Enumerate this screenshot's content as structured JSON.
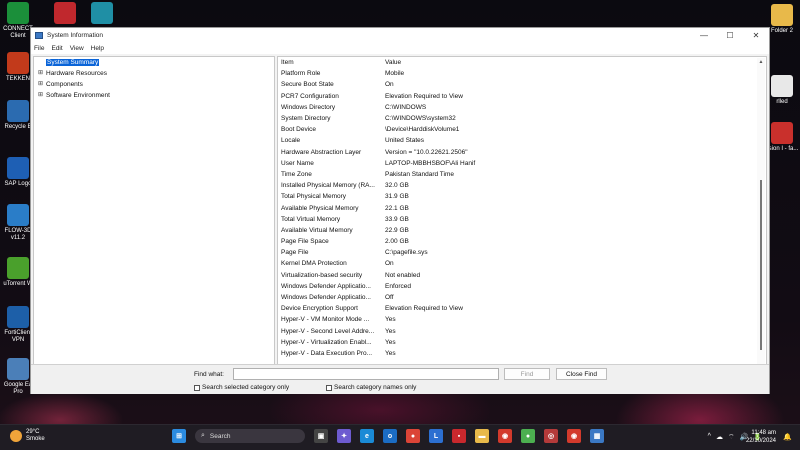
{
  "desktop": {
    "icons_left": [
      {
        "label": "CONNECT Client",
        "icon": "connect-icon",
        "color": "#1b8f3a"
      },
      {
        "label": "TEKKEN",
        "icon": "tekken-icon",
        "color": "#c23a1b"
      },
      {
        "label": "Recycle B",
        "icon": "recycle-bin-icon",
        "color": "#2b6bb0"
      },
      {
        "label": "SAP Logo",
        "icon": "sap-icon",
        "color": "#1e5fb4"
      },
      {
        "label": "FLOW-3D v11.2",
        "icon": "flow3d-icon",
        "color": "#2a7dc8"
      },
      {
        "label": "uTorrent W",
        "icon": "utorrent-icon",
        "color": "#4aa02c"
      },
      {
        "label": "FortiClient VPN",
        "icon": "forticlient-icon",
        "color": "#1d5fa8"
      },
      {
        "label": "Google Ea Pro",
        "icon": "google-earth-icon",
        "color": "#4b7fb8"
      }
    ],
    "icons_top": [
      {
        "label": "",
        "icon": "autocad-icon",
        "color": "#c0282d"
      },
      {
        "label": "",
        "icon": "app-icon",
        "color": "#1f8fa5"
      }
    ],
    "icons_right": [
      {
        "label": "Folder 2",
        "icon": "folder-icon",
        "color": "#e8b94a"
      },
      {
        "label": "rlled",
        "icon": "file-icon",
        "color": "#e8e8e8"
      },
      {
        "label": "ssion I - fa...",
        "icon": "pdf-icon",
        "color": "#c9302c"
      }
    ]
  },
  "window": {
    "title": "System Information",
    "controls": {
      "minimize": "—",
      "maximize": "☐",
      "close": "✕"
    },
    "menu": [
      "File",
      "Edit",
      "View",
      "Help"
    ],
    "tree": [
      {
        "label": "System Summary",
        "expander": "",
        "selected": true
      },
      {
        "label": "Hardware Resources",
        "expander": "⊞",
        "selected": false
      },
      {
        "label": "Components",
        "expander": "⊞",
        "selected": false
      },
      {
        "label": "Software Environment",
        "expander": "⊞",
        "selected": false
      }
    ],
    "columns": {
      "item": "Item",
      "value": "Value"
    },
    "rows": [
      {
        "item": "Platform Role",
        "value": "Mobile"
      },
      {
        "item": "Secure Boot State",
        "value": "On"
      },
      {
        "item": "PCR7 Configuration",
        "value": "Elevation Required to View"
      },
      {
        "item": "Windows Directory",
        "value": "C:\\WINDOWS"
      },
      {
        "item": "System Directory",
        "value": "C:\\WINDOWS\\system32"
      },
      {
        "item": "Boot Device",
        "value": "\\Device\\HarddiskVolume1"
      },
      {
        "item": "Locale",
        "value": "United States"
      },
      {
        "item": "Hardware Abstraction Layer",
        "value": "Version = \"10.0.22621.2506\""
      },
      {
        "item": "User Name",
        "value": "LAPTOP-MBBHSBOF\\Ali Hanif"
      },
      {
        "item": "Time Zone",
        "value": "Pakistan Standard Time"
      },
      {
        "item": "Installed Physical Memory (RA...",
        "value": "32.0 GB"
      },
      {
        "item": "Total Physical Memory",
        "value": "31.9 GB"
      },
      {
        "item": "Available Physical Memory",
        "value": "22.1 GB"
      },
      {
        "item": "Total Virtual Memory",
        "value": "33.9 GB"
      },
      {
        "item": "Available Virtual Memory",
        "value": "22.9 GB"
      },
      {
        "item": "Page File Space",
        "value": "2.00 GB"
      },
      {
        "item": "Page File",
        "value": "C:\\pagefile.sys"
      },
      {
        "item": "Kernel DMA Protection",
        "value": "On"
      },
      {
        "item": "Virtualization-based security",
        "value": "Not enabled"
      },
      {
        "item": "Windows Defender Applicatio...",
        "value": "Enforced"
      },
      {
        "item": "Windows Defender Applicatio...",
        "value": "Off"
      },
      {
        "item": "Device Encryption Support",
        "value": "Elevation Required to View"
      },
      {
        "item": "Hyper-V - VM Monitor Mode ...",
        "value": "Yes"
      },
      {
        "item": "Hyper-V - Second Level Addre...",
        "value": "Yes"
      },
      {
        "item": "Hyper-V - Virtualization Enabl...",
        "value": "Yes"
      },
      {
        "item": "Hyper-V - Data Execution Pro...",
        "value": "Yes"
      }
    ],
    "find": {
      "label": "Find what:",
      "value": "",
      "find_button": "Find",
      "close_find_button": "Close Find",
      "search_selected": "Search selected category only",
      "search_names": "Search category names only"
    }
  },
  "taskbar": {
    "weather_temp": "29°C",
    "weather_desc": "Smoke",
    "search_label": "Search",
    "apps": [
      {
        "icon": "windows-start-icon",
        "color": "#2b8be0",
        "glyph": "⊞"
      },
      {
        "icon": "task-view-icon",
        "color": "#444",
        "glyph": "▣"
      },
      {
        "icon": "copilot-icon",
        "color": "#6d5bd0",
        "glyph": "✦"
      },
      {
        "icon": "edge-icon",
        "color": "#1a8ad6",
        "glyph": "e"
      },
      {
        "icon": "outlook-icon",
        "color": "#1b6cc4",
        "glyph": "o"
      },
      {
        "icon": "chrome-icon",
        "color": "#db4437",
        "glyph": "●"
      },
      {
        "icon": "lens-icon",
        "color": "#2c6fd1",
        "glyph": "L"
      },
      {
        "icon": "app-red-icon",
        "color": "#c8282d",
        "glyph": "▪"
      },
      {
        "icon": "file-explorer-icon",
        "color": "#e8b94a",
        "glyph": "▬"
      },
      {
        "icon": "camera-icon",
        "color": "#d33a2c",
        "glyph": "◉"
      },
      {
        "icon": "chrome-alt-icon",
        "color": "#4caf50",
        "glyph": "●"
      },
      {
        "icon": "zoom-icon",
        "color": "#b43a3a",
        "glyph": "◎"
      },
      {
        "icon": "recorder-icon",
        "color": "#d33a2c",
        "glyph": "◉"
      },
      {
        "icon": "system-information-icon",
        "color": "#3b78c4",
        "glyph": "▦"
      }
    ],
    "tray": [
      "^",
      "☁",
      "⌔",
      "🔊",
      "🔋"
    ],
    "time": "11:48 am",
    "date": "22/10/2024",
    "bell": "🔔"
  }
}
